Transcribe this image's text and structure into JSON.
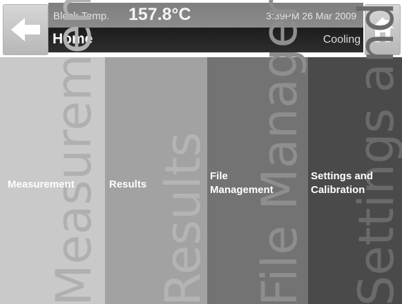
{
  "header": {
    "block_temp_label": "Block Temp.",
    "block_temp_value": "157.8°C",
    "datetime": "3:39PM 26 Mar 2009",
    "page_title": "Home",
    "status": "Cooling",
    "back_icon": "arrow-left-icon",
    "home_icon": "home-icon"
  },
  "menu": {
    "items": [
      {
        "label": "Measurement",
        "ghost": "Measurement"
      },
      {
        "label": "Results",
        "ghost": "Results"
      },
      {
        "label": "File\nManagement",
        "ghost": "File Management"
      },
      {
        "label": "Settings and\nCalibration",
        "ghost": "Settings and"
      }
    ]
  },
  "colors": {
    "panel_1": "#c9c9c9",
    "panel_2": "#a2a2a2",
    "panel_3": "#737373",
    "panel_4": "#4a4a4a",
    "title_bar": "#1d1d1d",
    "status_bar": "#7f7f7f"
  }
}
